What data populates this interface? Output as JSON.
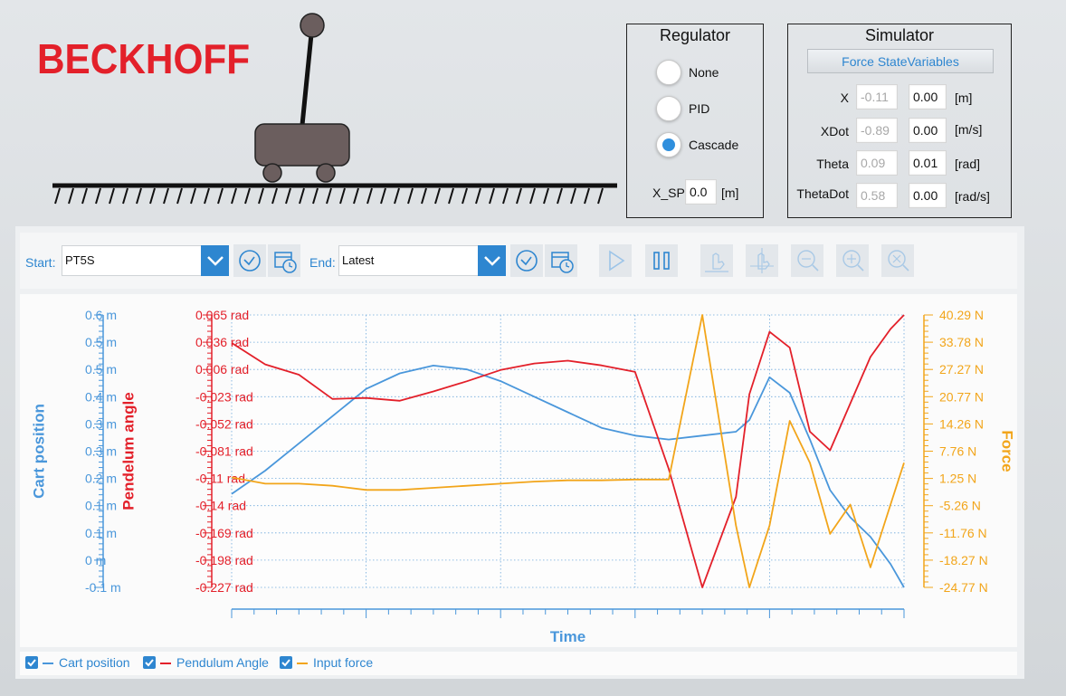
{
  "logo": {
    "text": "BECKHOFF"
  },
  "regulator": {
    "title": "Regulator",
    "options": [
      {
        "label": "None",
        "selected": false
      },
      {
        "label": "PID",
        "selected": false
      },
      {
        "label": "Cascade",
        "selected": true
      }
    ],
    "xsp_label": "X_SP",
    "xsp_value": "0.0",
    "xsp_unit": "[m]"
  },
  "simulator": {
    "title": "Simulator",
    "button": "Force StateVariables",
    "rows": [
      {
        "label": "X",
        "current": "-0.11",
        "set": "0.00",
        "unit": "[m]"
      },
      {
        "label": "XDot",
        "current": "-0.89",
        "set": "0.00",
        "unit": "[m/s]"
      },
      {
        "label": "Theta",
        "current": "0.09",
        "set": "0.01",
        "unit": "[rad]"
      },
      {
        "label": "ThetaDot",
        "current": "0.58",
        "set": "0.00",
        "unit": "[rad/s]"
      }
    ]
  },
  "toolbar": {
    "start_label": "Start:",
    "start_value": "PT5S",
    "end_label": "End:",
    "end_value": "Latest"
  },
  "legend": {
    "items": [
      {
        "label": "Cart position",
        "color": "#4a97db",
        "checked": true
      },
      {
        "label": "Pendulum Angle",
        "color": "#e3202a",
        "checked": true
      },
      {
        "label": "Input force",
        "color": "#f2a51a",
        "checked": true
      }
    ]
  },
  "chart_data": {
    "type": "line",
    "xlabel": "Time",
    "axes": [
      {
        "label": "Cart position",
        "side": "left",
        "color": "#4a97db",
        "ticks": [
          "0.6 m",
          "0.5 m",
          "0.5 m",
          "0.4 m",
          "0.3 m",
          "0.3 m",
          "0.2 m",
          "0.1 m",
          "0.1 m",
          "0 m",
          "-0.1 m"
        ],
        "ylim": [
          -0.1,
          0.6
        ]
      },
      {
        "label": "Pendelum angle",
        "side": "left",
        "color": "#e3202a",
        "ticks": [
          "0.065 rad",
          "0.036 rad",
          "0.006 rad",
          "-0.023 rad",
          "-0.052 rad",
          "-0.081 rad",
          "-0.11 rad",
          "-0.14 rad",
          "-0.169 rad",
          "-0.198 rad",
          "-0.227 rad"
        ],
        "ylim": [
          -0.227,
          0.065
        ]
      },
      {
        "label": "Force",
        "side": "right",
        "color": "#f2a51a",
        "ticks": [
          "40.29 N",
          "33.78 N",
          "27.27 N",
          "20.77 N",
          "14.26 N",
          "7.76 N",
          "1.25 N",
          "-5.26 N",
          "-11.76 N",
          "-18.27 N",
          "-24.77 N"
        ],
        "ylim": [
          -24.77,
          40.29
        ]
      }
    ],
    "x": [
      0,
      0.05,
      0.1,
      0.15,
      0.2,
      0.25,
      0.3,
      0.35,
      0.4,
      0.45,
      0.5,
      0.55,
      0.6,
      0.65,
      0.7,
      0.75,
      0.77,
      0.8,
      0.83,
      0.86,
      0.89,
      0.92,
      0.95,
      0.98,
      1.0
    ],
    "series": [
      {
        "name": "Cart position",
        "axis": 0,
        "values": [
          0.14,
          0.2,
          0.27,
          0.34,
          0.41,
          0.45,
          0.47,
          0.46,
          0.43,
          0.39,
          0.35,
          0.31,
          0.29,
          0.28,
          0.29,
          0.3,
          0.33,
          0.44,
          0.4,
          0.28,
          0.15,
          0.08,
          0.03,
          -0.04,
          -0.1
        ]
      },
      {
        "name": "Pendulum Angle",
        "axis": 1,
        "values": [
          0.035,
          0.012,
          0.001,
          -0.025,
          -0.024,
          -0.027,
          -0.017,
          -0.006,
          0.006,
          0.013,
          0.016,
          0.011,
          0.004,
          -0.1,
          -0.227,
          -0.13,
          -0.02,
          0.047,
          0.03,
          -0.06,
          -0.08,
          -0.03,
          0.02,
          0.05,
          0.065
        ]
      },
      {
        "name": "Input force",
        "axis": 2,
        "values": [
          1.5,
          0.0,
          0.0,
          -0.5,
          -1.5,
          -1.5,
          -1.0,
          -0.5,
          0.0,
          0.5,
          0.8,
          0.8,
          1.0,
          1.0,
          40.29,
          -10,
          -24.77,
          -10,
          15,
          5,
          -12,
          -5,
          -20,
          -5,
          5
        ]
      }
    ],
    "grid": true
  }
}
